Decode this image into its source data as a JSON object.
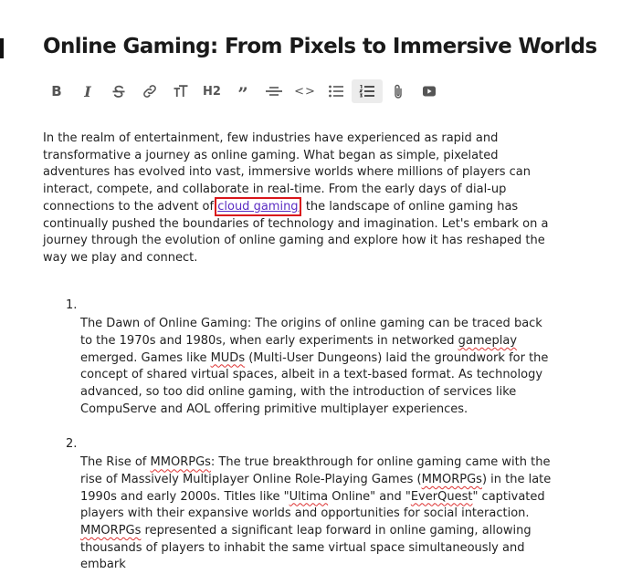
{
  "article": {
    "title": "Online Gaming: From Pixels to Immersive Worlds",
    "intro": {
      "before_link": "In the realm of entertainment, few industries have experienced as rapid and transformative a journey as online gaming. What began as simple, pixelated adventures has evolved into vast, immersive worlds where millions of players can interact, compete, and collaborate in real-time. From the early days of dial-up connections to the advent of ",
      "link_text": "cloud gaming",
      "after_link": ", the landscape of online gaming has continually pushed the boundaries of technology and imagination. Let's embark on a journey through the evolution of online gaming and explore how it has reshaped the way we play and connect."
    },
    "list": [
      {
        "number": "1.",
        "s1": "The Dawn of Online Gaming: The origins of online gaming can be traced back to the 1970s and 1980s, when early experiments in networked ",
        "w1": "gameplay",
        "s2": " emerged. Games like ",
        "w2": "MUDs",
        "s3": " (Multi-User Dungeons) laid the groundwork for the concept of shared virtual spaces, albeit in a text-based format. As technology advanced, so too did online gaming, with the introduction of services like CompuServe and AOL offering primitive multiplayer experiences."
      },
      {
        "number": "2.",
        "s1": "The Rise of ",
        "w1": "MMORPGs",
        "s2": ": The true breakthrough for online gaming came with the rise of Massively Multiplayer Online Role-Playing Games (",
        "w2": "MMORPGs",
        "s3": ") in the late 1990s and early 2000s. Titles like \"",
        "w3": "Ultima",
        "s4": " Online\" and \"",
        "w4": "EverQuest",
        "s5": "\" captivated players with their expansive worlds and opportunities for social interaction. ",
        "w5": "MMORPGs",
        "s6": " represented a significant leap forward in online gaming, allowing thousands of players to inhabit the same virtual space simultaneously and embark"
      }
    ]
  },
  "toolbar": {
    "bold": "B",
    "italic": "I",
    "heading": "H2",
    "quote": "”",
    "code": "<>"
  }
}
